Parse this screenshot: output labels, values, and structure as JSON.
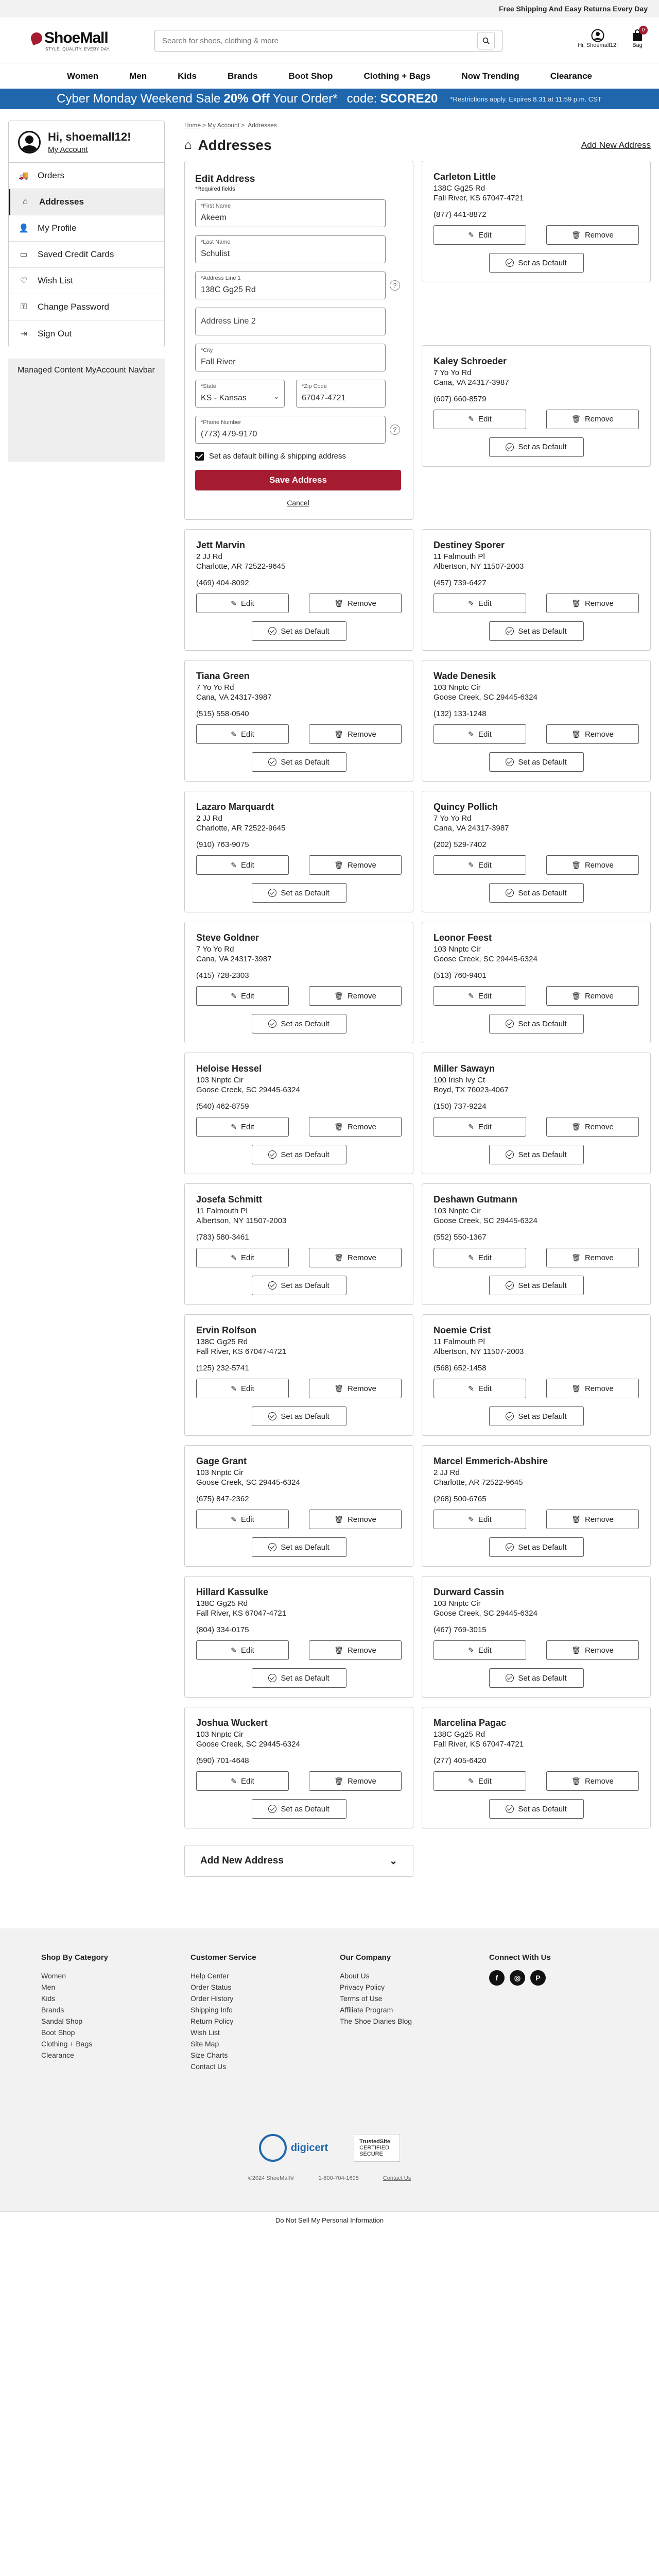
{
  "topbar": {
    "promo": "Free Shipping And Easy Returns Every Day"
  },
  "header": {
    "logo": "ShoeMall",
    "logo_tagline": "STYLE. QUALITY. EVERY DAY.",
    "search_placeholder": "Search for shoes, clothing & more",
    "account_label": "Hi, Shoemall12!",
    "bag_label": "Bag",
    "bag_count": "0"
  },
  "nav": [
    "Women",
    "Men",
    "Kids",
    "Brands",
    "Boot Shop",
    "Clothing + Bags",
    "Now Trending",
    "Clearance"
  ],
  "promo": {
    "lead": "Cyber Monday Weekend Sale",
    "highlight": "20% Off",
    "tail": "Your Order*",
    "code_label": "code:",
    "code": "SCORE20",
    "fine": "*Restrictions apply. Expires 8.31 at 11:59 p.m. CST"
  },
  "sidebar": {
    "greeting": "Hi, shoemall12!",
    "my_account": "My Account",
    "items": [
      {
        "label": "Orders",
        "icon": "truck-icon",
        "glyph": "🚚"
      },
      {
        "label": "Addresses",
        "icon": "home-icon",
        "glyph": "⌂"
      },
      {
        "label": "My Profile",
        "icon": "profile-icon",
        "glyph": "👤"
      },
      {
        "label": "Saved Credit Cards",
        "icon": "credit-card-icon",
        "glyph": "▭"
      },
      {
        "label": "Wish List",
        "icon": "heart-icon",
        "glyph": "♡"
      },
      {
        "label": "Change Password",
        "icon": "key-icon",
        "glyph": "⚿"
      },
      {
        "label": "Sign Out",
        "icon": "sign-out-icon",
        "glyph": "⇥"
      }
    ],
    "managed": "Managed Content MyAccount Navbar"
  },
  "breadcrumb": [
    "Home",
    "My Account",
    "Addresses"
  ],
  "page": {
    "title": "Addresses",
    "add_new": "Add New Address"
  },
  "edit_form": {
    "title": "Edit Address",
    "required_note": "*Required fields",
    "first_name": {
      "label": "*First Name",
      "value": "Akeem"
    },
    "last_name": {
      "label": "*Last Name",
      "value": "Schulist"
    },
    "address1": {
      "label": "*Address Line 1",
      "value": "138C Gg25 Rd"
    },
    "address2": {
      "placeholder": "Address Line 2"
    },
    "city": {
      "label": "*City",
      "value": "Fall River"
    },
    "state": {
      "label": "*State",
      "value": "KS - Kansas"
    },
    "zip": {
      "label": "*Zip Code",
      "value": "67047-4721"
    },
    "phone": {
      "label": "*Phone Number",
      "value": "(773) 479-9170"
    },
    "default_label": "Set as default billing & shipping address",
    "save": "Save Address",
    "cancel": "Cancel"
  },
  "buttons": {
    "edit": "Edit",
    "remove": "Remove",
    "default": "Set as Default"
  },
  "addresses": [
    {
      "name": "Carleton Little",
      "line1": "138C Gg25 Rd",
      "line2": "Fall River, KS 67047-4721",
      "phone": "(877) 441-8872"
    },
    {
      "name": "Kaley Schroeder",
      "line1": "7 Yo Yo Rd",
      "line2": "Cana, VA 24317-3987",
      "phone": "(607) 660-8579"
    },
    {
      "name": "Jett Marvin",
      "line1": "2 JJ Rd",
      "line2": "Charlotte, AR 72522-9645",
      "phone": "(469) 404-8092"
    },
    {
      "name": "Destiney Sporer",
      "line1": "11 Falmouth Pl",
      "line2": "Albertson, NY 11507-2003",
      "phone": "(457) 739-6427"
    },
    {
      "name": "Tiana Green",
      "line1": "7 Yo Yo Rd",
      "line2": "Cana, VA 24317-3987",
      "phone": "(515) 558-0540"
    },
    {
      "name": "Wade Denesik",
      "line1": "103 Nnptc Cir",
      "line2": "Goose Creek, SC 29445-6324",
      "phone": "(132) 133-1248"
    },
    {
      "name": "Lazaro Marquardt",
      "line1": "2 JJ Rd",
      "line2": "Charlotte, AR 72522-9645",
      "phone": "(910) 763-9075"
    },
    {
      "name": "Quincy Pollich",
      "line1": "7 Yo Yo Rd",
      "line2": "Cana, VA 24317-3987",
      "phone": "(202) 529-7402"
    },
    {
      "name": "Steve Goldner",
      "line1": "7 Yo Yo Rd",
      "line2": "Cana, VA 24317-3987",
      "phone": "(415) 728-2303"
    },
    {
      "name": "Leonor Feest",
      "line1": "103 Nnptc Cir",
      "line2": "Goose Creek, SC 29445-6324",
      "phone": "(513) 760-9401"
    },
    {
      "name": "Heloise Hessel",
      "line1": "103 Nnptc Cir",
      "line2": "Goose Creek, SC 29445-6324",
      "phone": "(540) 462-8759"
    },
    {
      "name": "Miller Sawayn",
      "line1": "100 Irish Ivy Ct",
      "line2": "Boyd, TX 76023-4067",
      "phone": "(150) 737-9224"
    },
    {
      "name": "Josefa Schmitt",
      "line1": "11 Falmouth Pl",
      "line2": "Albertson, NY 11507-2003",
      "phone": "(783) 580-3461"
    },
    {
      "name": "Deshawn Gutmann",
      "line1": "103 Nnptc Cir",
      "line2": "Goose Creek, SC 29445-6324",
      "phone": "(552) 550-1367"
    },
    {
      "name": "Ervin Rolfson",
      "line1": "138C Gg25 Rd",
      "line2": "Fall River, KS 67047-4721",
      "phone": "(125) 232-5741"
    },
    {
      "name": "Noemie Crist",
      "line1": "11 Falmouth Pl",
      "line2": "Albertson, NY 11507-2003",
      "phone": "(568) 652-1458"
    },
    {
      "name": "Gage Grant",
      "line1": "103 Nnptc Cir",
      "line2": "Goose Creek, SC 29445-6324",
      "phone": "(675) 847-2362"
    },
    {
      "name": "Marcel Emmerich-Abshire",
      "line1": "2 JJ Rd",
      "line2": "Charlotte, AR 72522-9645",
      "phone": "(268) 500-6765"
    },
    {
      "name": "Hillard Kassulke",
      "line1": "138C Gg25 Rd",
      "line2": "Fall River, KS 67047-4721",
      "phone": "(804) 334-0175"
    },
    {
      "name": "Durward Cassin",
      "line1": "103 Nnptc Cir",
      "line2": "Goose Creek, SC 29445-6324",
      "phone": "(467) 769-3015"
    },
    {
      "name": "Joshua Wuckert",
      "line1": "103 Nnptc Cir",
      "line2": "Goose Creek, SC 29445-6324",
      "phone": "(590) 701-4648"
    },
    {
      "name": "Marcelina Pagac",
      "line1": "138C Gg25 Rd",
      "line2": "Fall River, KS 67047-4721",
      "phone": "(277) 405-6420"
    }
  ],
  "add_accordion": "Add New Address",
  "footer": {
    "cols": [
      {
        "title": "Shop By Category",
        "links": [
          "Women",
          "Men",
          "Kids",
          "Brands",
          "Sandal Shop",
          "Boot Shop",
          "Clothing + Bags",
          "Clearance"
        ]
      },
      {
        "title": "Customer Service",
        "links": [
          "Help Center",
          "Order Status",
          "Order History",
          "Shipping Info",
          "Return Policy",
          "Wish List",
          "Site Map",
          "Size Charts",
          "Contact Us"
        ]
      },
      {
        "title": "Our Company",
        "links": [
          "About Us",
          "Privacy Policy",
          "Terms of Use",
          "Affiliate Program",
          "The Shoe Diaries Blog"
        ]
      }
    ],
    "connect": "Connect With Us",
    "social": [
      "f",
      "◎",
      "P"
    ],
    "digicert": "digicert",
    "trusted": "TrustedSite",
    "trusted_sub": "CERTIFIED SECURE",
    "copyright": "©2024 ShoeMall®",
    "phone": "1-800-704-1698",
    "contact": "Contact Us",
    "donotsell": "Do Not Sell My Personal Information"
  },
  "colors": {
    "brand": "#a51c30",
    "promo_bg": "#1f66ad"
  }
}
